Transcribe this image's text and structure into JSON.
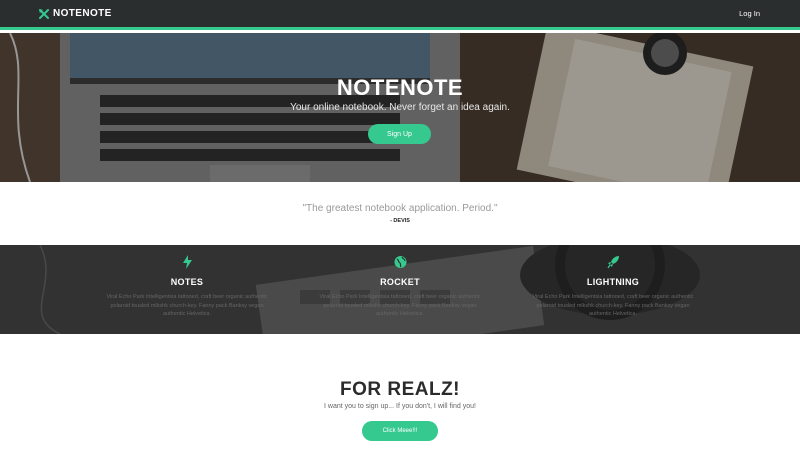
{
  "nav": {
    "brand": "NOTENOTE",
    "login_label": "Log In"
  },
  "hero": {
    "title": "NOTENOTE",
    "subtitle": "Your online notebook. Never forget an idea again.",
    "signup_label": "Sign Up"
  },
  "quote": {
    "text": "\"The greatest notebook application. Period.\"",
    "author": "- DEVIS"
  },
  "features": [
    {
      "icon": "lightning-icon",
      "title": "NOTES",
      "description": "Viral Echo Park Intelligentsia tattooed, craft beer organic authentic polaroid tousled mlkshk church-key. Fanny pack Banksy vegan authentic Helvetica."
    },
    {
      "icon": "globe-icon",
      "title": "ROCKET",
      "description": "Viral Echo Park Intelligentsia tattooed, craft beer organic authentic polaroid tousled mlkshk church-key. Fanny pack Banksy vegan authentic Helvetica."
    },
    {
      "icon": "rocket-icon",
      "title": "LIGHTNING",
      "description": "Viral Echo Park Intelligentsia tattooed, craft beer organic authentic polaroid tousled mlkshk church-key. Fanny pack Banksy vegan authentic Helvetica."
    }
  ],
  "cta": {
    "title": "FOR REALZ!",
    "subtitle": "I want you to sign up... If you don't, I will find you!",
    "button_label": "Click Meee!!!"
  },
  "colors": {
    "accent": "#35c88f",
    "nav_bg": "#2b2e2f"
  }
}
